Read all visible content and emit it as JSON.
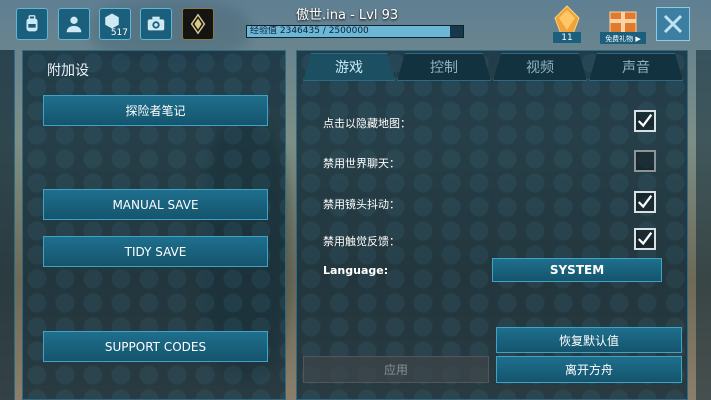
{
  "top_bar": {
    "player_title": "傲世.ina - Lvl 93",
    "xp_text": "经验值 2346435 / 2500000",
    "xp_progress": 0.9386,
    "tribe_count": "517",
    "gem_count": "11",
    "gift_label": "免费礼物 ▶"
  },
  "left_panel": {
    "title": "附加设",
    "buttons": {
      "explorer_notes": "探险者笔记",
      "manual_save": "MANUAL SAVE",
      "tidy_save": "TIDY SAVE",
      "support_codes": "SUPPORT CODES"
    }
  },
  "tabs": {
    "game": "游戏",
    "controls": "控制",
    "video": "视频",
    "audio": "声音"
  },
  "settings": {
    "hide_map": {
      "label": "点击以隐藏地图：",
      "checked": true
    },
    "disable_chat": {
      "label": "禁用世界聊天：",
      "checked": false
    },
    "disable_shake": {
      "label": "禁用镜头抖动：",
      "checked": true
    },
    "disable_haptic": {
      "label": "禁用触觉反馈：",
      "checked": true
    },
    "language_label": "Language:",
    "language_value": "SYSTEM"
  },
  "actions": {
    "reset_defaults": "恢复默认值",
    "apply": "应用",
    "leave_ark": "离开方舟"
  },
  "colors": {
    "accent": "#3fa3c6",
    "panel": "#0e2836",
    "xp_fill": "#6cb7d6"
  }
}
